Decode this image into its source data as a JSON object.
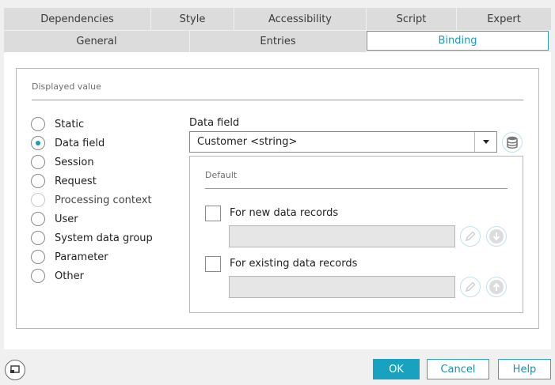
{
  "tabs_row1": [
    "Dependencies",
    "Style",
    "Accessibility",
    "Script",
    "Expert"
  ],
  "tabs_row2": [
    "General",
    "Entries",
    "Binding"
  ],
  "displayed_value": {
    "legend": "Displayed value",
    "options": [
      {
        "label": "Static",
        "checked": false,
        "disabled": false
      },
      {
        "label": "Data field",
        "checked": true,
        "disabled": false
      },
      {
        "label": "Session",
        "checked": false,
        "disabled": false
      },
      {
        "label": "Request",
        "checked": false,
        "disabled": false
      },
      {
        "label": "Processing context",
        "checked": false,
        "disabled": true
      },
      {
        "label": "User",
        "checked": false,
        "disabled": false
      },
      {
        "label": "System data group",
        "checked": false,
        "disabled": false
      },
      {
        "label": "Parameter",
        "checked": false,
        "disabled": false
      },
      {
        "label": "Other",
        "checked": false,
        "disabled": false
      }
    ]
  },
  "data_field": {
    "label": "Data field",
    "value": "Customer <string>"
  },
  "default_group": {
    "legend": "Default",
    "new_records_label": "For new data records",
    "existing_records_label": "For existing data records",
    "new_records_value": "",
    "existing_records_value": ""
  },
  "footer": {
    "ok": "OK",
    "cancel": "Cancel",
    "help": "Help"
  },
  "colors": {
    "accent": "#18a2c0"
  }
}
